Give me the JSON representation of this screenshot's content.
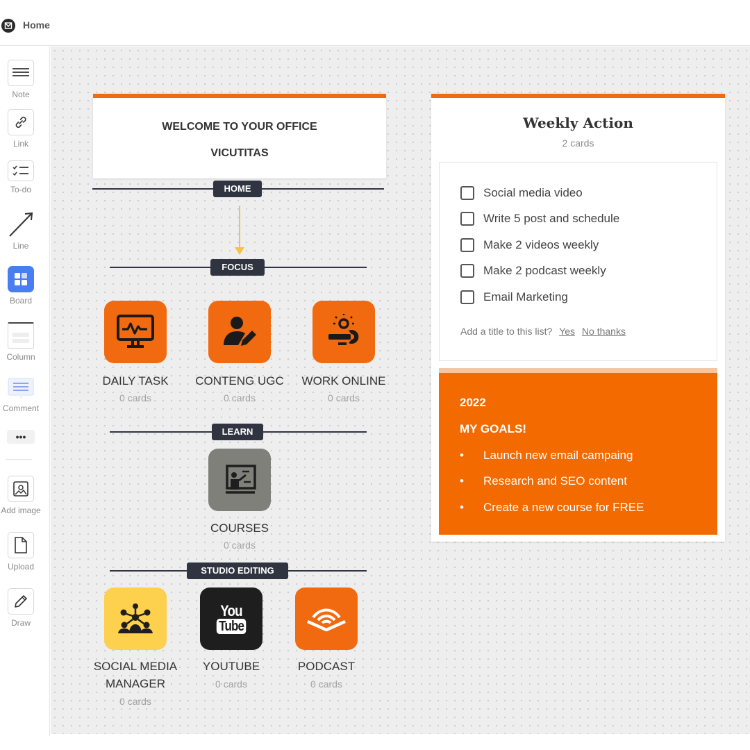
{
  "header": {
    "title": "Home"
  },
  "sidebar": {
    "tools": [
      {
        "label": "Note",
        "icon": "note-icon"
      },
      {
        "label": "Link",
        "icon": "link-icon"
      },
      {
        "label": "To-do",
        "icon": "todo-icon"
      },
      {
        "label": "Line",
        "icon": "line-icon"
      },
      {
        "label": "Board",
        "icon": "board-icon"
      },
      {
        "label": "Column",
        "icon": "column-icon"
      },
      {
        "label": "Comment",
        "icon": "comment-icon"
      },
      {
        "label": "Add image",
        "icon": "image-icon"
      },
      {
        "label": "Upload",
        "icon": "upload-icon"
      },
      {
        "label": "Draw",
        "icon": "pencil-icon"
      }
    ],
    "more": "•••"
  },
  "welcome": {
    "line1": "WELCOME TO YOUR OFFICE",
    "line2": "VICUTITAS"
  },
  "sections": {
    "home": "HOME",
    "focus": "FOCUS",
    "learn": "LEARN",
    "studio": "STUDIO EDITING"
  },
  "boards": {
    "daily_task": {
      "title": "DAILY TASK",
      "count": "0 cards",
      "color": "#f26a10",
      "icon": "monitor-chart-icon"
    },
    "content_ugc": {
      "title": "CONTENG UGC",
      "count": "0 cards",
      "color": "#f26a10",
      "icon": "user-edit-icon"
    },
    "work_online": {
      "title": "WORK ONLINE",
      "count": "0 cards",
      "color": "#f26a10",
      "icon": "wrench-bulb-icon"
    },
    "courses": {
      "title": "COURSES",
      "count": "0 cards",
      "color": "#7f8079",
      "icon": "presentation-icon"
    },
    "social_media": {
      "title_line1": "SOCIAL MEDIA",
      "title_line2": "MANAGER",
      "count": "0 cards",
      "color": "#fdd04d",
      "icon": "network-icon"
    },
    "youtube": {
      "title": "YOUTUBE",
      "count": "0 cards",
      "color": "#1e1e1e",
      "icon": "youtube-icon",
      "logo_top": "You",
      "logo_bottom": "Tube"
    },
    "podcast": {
      "title": "PODCAST",
      "count": "0 cards",
      "color": "#f26a10",
      "icon": "audible-icon"
    }
  },
  "weekly": {
    "title": "Weekly Action",
    "count": "2 cards",
    "todos": [
      "Social media video",
      "Write 5 post and schedule",
      "Make 2 videos weekly",
      "Make 2 podcast weekly",
      "Email Marketing"
    ],
    "prompt": "Add a title to this list?",
    "yes": "Yes",
    "no": "No thanks"
  },
  "goals": {
    "year": "2022",
    "heading": "MY GOALS!",
    "items": [
      "Launch new email campaing",
      "Research and SEO content",
      "Create a new course for FREE"
    ]
  }
}
